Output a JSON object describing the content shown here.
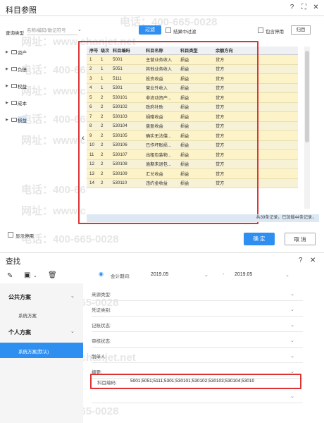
{
  "dialog": {
    "title": "科目参照",
    "search_label": "查询类型",
    "search_placeholder": "名称/编码/助记符号",
    "filter_button": "过滤",
    "filter_in_result_label": "结果中过滤",
    "include_disabled_label": "包含停用",
    "clear_button": "归目",
    "tree": [
      "资产",
      "负债",
      "权益",
      "成本",
      "损益"
    ],
    "columns": [
      "序号",
      "级次",
      "科目编码",
      "科目名称",
      "科目类型",
      "余额方向"
    ],
    "rows": [
      [
        "1",
        "1",
        "5001",
        "主营业务收入",
        "损益",
        "贷方"
      ],
      [
        "2",
        "1",
        "5051",
        "其他业务收入",
        "损益",
        "贷方"
      ],
      [
        "3",
        "1",
        "5111",
        "投资收益",
        "损益",
        "贷方"
      ],
      [
        "4",
        "1",
        "5301",
        "营业外收入",
        "损益",
        "贷方"
      ],
      [
        "5",
        "2",
        "530101",
        "非流动资产...",
        "损益",
        "贷方"
      ],
      [
        "6",
        "2",
        "530102",
        "政府补助",
        "损益",
        "贷方"
      ],
      [
        "7",
        "2",
        "530103",
        "捐赠收益",
        "损益",
        "贷方"
      ],
      [
        "8",
        "2",
        "530104",
        "盘盈收益",
        "损益",
        "贷方"
      ],
      [
        "9",
        "2",
        "530105",
        "确实无法偿...",
        "损益",
        "贷方"
      ],
      [
        "10",
        "2",
        "530106",
        "已作坏账损...",
        "损益",
        "贷方"
      ],
      [
        "11",
        "2",
        "530107",
        "出租包装物...",
        "损益",
        "贷方"
      ],
      [
        "12",
        "2",
        "530108",
        "逾期未退包...",
        "损益",
        "贷方"
      ],
      [
        "13",
        "2",
        "530109",
        "汇兑收益",
        "损益",
        "贷方"
      ],
      [
        "14",
        "2",
        "530110",
        "违约金收益",
        "损益",
        "贷方"
      ]
    ],
    "status": "共39条记录，已加载44条记录，",
    "show_stopped_label": "显示停用",
    "ok_button": "确 定",
    "cancel_button": "取 消"
  },
  "find": {
    "title": "查找",
    "public_scheme": "公共方案",
    "system_scheme": "系统方案",
    "personal_scheme": "个人方案",
    "personal_default": "系统方案(默认)",
    "period_label": "会计期间:",
    "period_from": "2019.05",
    "period_to": "2019.05",
    "fields": [
      "来源类型:",
      "凭证类别:",
      "记账状态:",
      "审核状态:",
      "制单人:",
      "摘要:"
    ],
    "code_label": "科目编码:",
    "code_value": "5001;5051;5111;5301;530101;530102;530103;530104;53010"
  },
  "watermark": {
    "phone": "电话：400-665-0028",
    "site": "网址：www.chanjet.net"
  }
}
